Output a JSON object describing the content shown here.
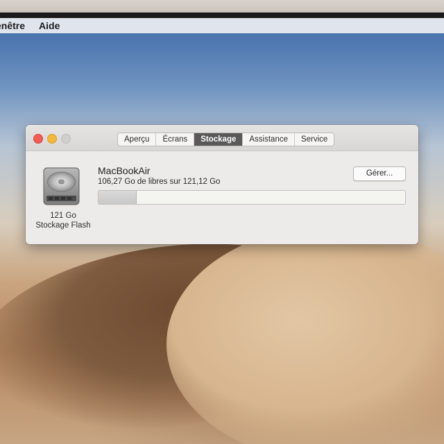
{
  "menubar": {
    "items": [
      "enêtre",
      "Aide"
    ]
  },
  "window": {
    "tabs": [
      {
        "label": "Aperçu",
        "active": false
      },
      {
        "label": "Écrans",
        "active": false
      },
      {
        "label": "Stockage",
        "active": true
      },
      {
        "label": "Assistance",
        "active": false
      },
      {
        "label": "Service",
        "active": false
      }
    ],
    "disk": {
      "capacity_label": "121 Go",
      "type_label": "Stockage Flash",
      "icon": "hard-drive-icon"
    },
    "volume": {
      "name": "MacBookAir",
      "free_text": "106,27 Go de libres sur 121,12 Go",
      "used_fraction": 0.123
    },
    "manage_label": "Gérer..."
  },
  "colors": {
    "close": "#ee5e56",
    "minimize": "#f2b73c",
    "zoom_disabled": "#d1cfcd",
    "active_tab": "#5a5959"
  }
}
